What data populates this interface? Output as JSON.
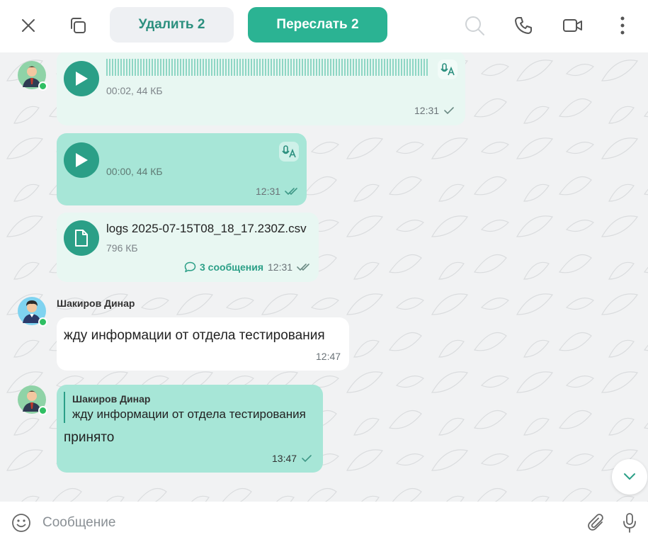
{
  "toolbar": {
    "delete_label": "Удалить 2",
    "forward_label": "Переслать 2",
    "icons": [
      "close-icon",
      "copy-icon",
      "search-icon",
      "phone-icon",
      "video-icon",
      "more-icon"
    ]
  },
  "messages": [
    {
      "type": "voice",
      "duration_size": "00:02, 44 КБ",
      "time": "12:31",
      "status": "sent",
      "selected": false
    },
    {
      "type": "voice",
      "duration_size": "00:00, 44 КБ",
      "time": "12:31",
      "status": "read",
      "selected": true
    },
    {
      "type": "file",
      "filename": "logs 2025-07-15T08_18_17.230Z.csv",
      "size": "796 КБ",
      "thread_label": "3 сообщения",
      "time": "12:31",
      "status": "read",
      "selected": false
    },
    {
      "type": "text",
      "sender": "Шакиров Динар",
      "text": "жду информации от отдела тестирования",
      "time": "12:47"
    },
    {
      "type": "reply",
      "quote_sender": "Шакиров Динар",
      "quote_text": "жду информации от отдела тестирования",
      "text": "принято",
      "time": "13:47",
      "status": "sent",
      "selected": true
    }
  ],
  "composer": {
    "placeholder": "Сообщение"
  },
  "colors": {
    "accent": "#2bb393",
    "bubble_mint": "#a7e6d7",
    "bubble_light": "#e8f7f2",
    "online": "#2fbf63"
  }
}
